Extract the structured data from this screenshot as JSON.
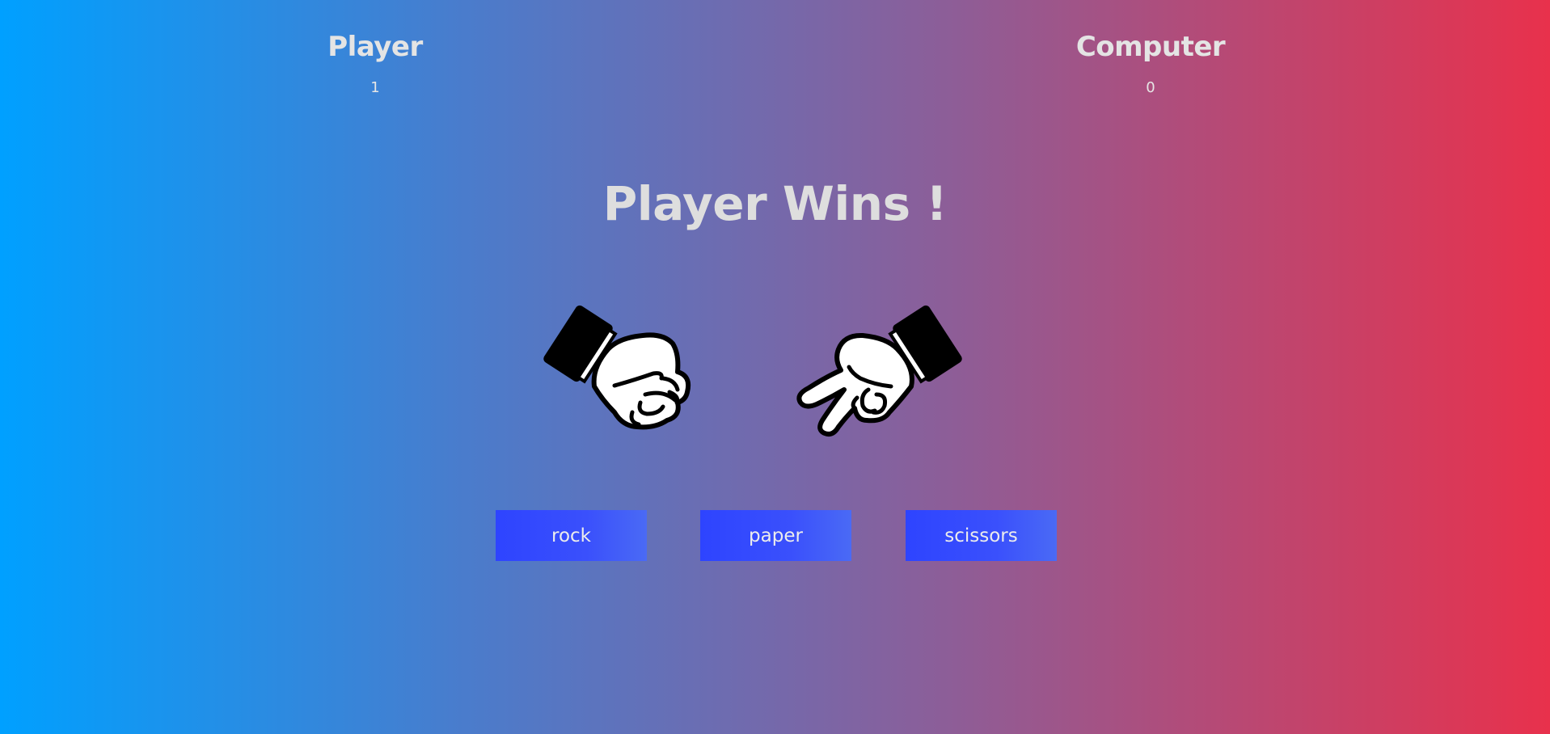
{
  "scores": {
    "player": {
      "label": "Player",
      "value": "1"
    },
    "computer": {
      "label": "Computer",
      "value": "0"
    }
  },
  "result": "Player Wins !",
  "hands": {
    "player": "rock-fist-icon",
    "computer": "scissors-hand-icon"
  },
  "buttons": [
    {
      "label": "rock"
    },
    {
      "label": "paper"
    },
    {
      "label": "scissors"
    }
  ]
}
